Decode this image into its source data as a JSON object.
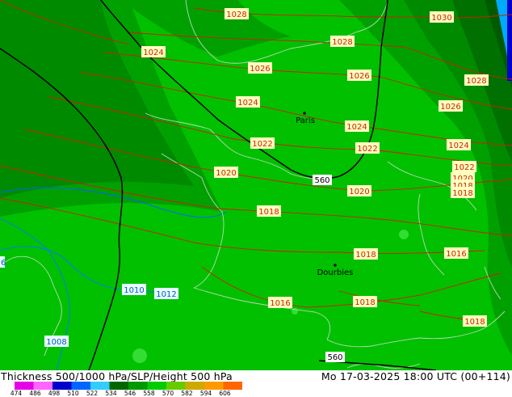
{
  "legend": {
    "title": "Thickness 500/1000 hPa/SLP/Height 500 hPa",
    "time": "Mo 17-03-2025 18:00 UTC (00+114)",
    "ticks": [
      "474",
      "486",
      "498",
      "510",
      "522",
      "534",
      "546",
      "558",
      "570",
      "582",
      "594",
      "606"
    ],
    "colors": [
      "#e600e6",
      "#ff66ff",
      "#0000cc",
      "#0066ff",
      "#33ccff",
      "#006600",
      "#009900",
      "#00cc00",
      "#66cc00",
      "#ccaa00",
      "#ff9900",
      "#ff6600"
    ]
  },
  "map": {
    "cities": [
      {
        "name": "Paris"
      },
      {
        "name": "Dourbies"
      }
    ],
    "isobars": [
      "1030",
      "1028",
      "1028",
      "1026",
      "1026",
      "1028",
      "1024",
      "1026",
      "1026",
      "1024",
      "1024",
      "1024",
      "1022",
      "1022",
      "1022",
      "1020",
      "1020",
      "1020",
      "1018",
      "1018",
      "1018",
      "1016",
      "1016",
      "1018",
      "1018",
      "1016",
      "1018",
      "1010",
      "1012",
      "1008",
      "6"
    ],
    "height_labels": [
      "560",
      "560"
    ],
    "colors": {
      "land_dark": "#007a00",
      "land_mid": "#00a000",
      "land_light": "#00c000",
      "isobar": "#cc2200",
      "height": "#000000",
      "label_bg": "#ffffc0",
      "blue_label_bg": "#e8ffff"
    }
  }
}
